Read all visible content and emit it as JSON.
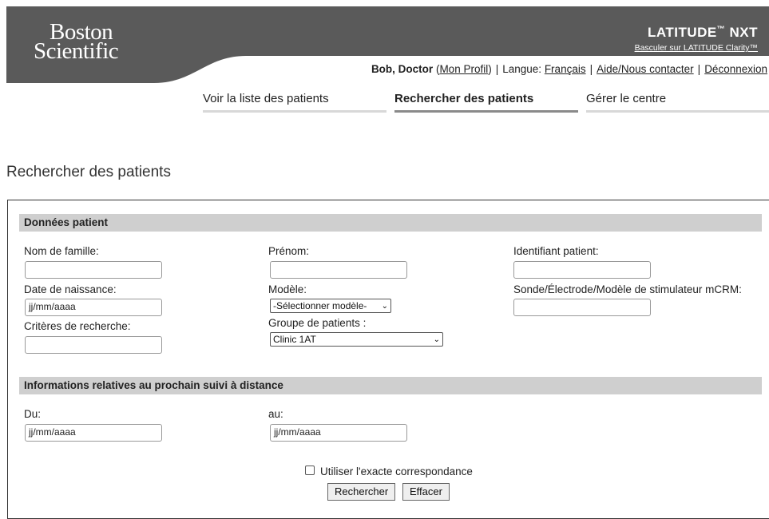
{
  "brand": {
    "logo_line1": "Boston",
    "logo_line2": "Scientific"
  },
  "product": {
    "name": "LATITUDE",
    "tm": "™",
    "suffix": " NXT",
    "switch_link": "Basculer sur LATITUDE Clarity™"
  },
  "userbar": {
    "user": "Bob, Doctor",
    "profile": "Mon Profil",
    "language_label": "Langue:",
    "language": "Français",
    "help": "Aide/Nous contacter",
    "logout": "Déconnexion"
  },
  "nav": {
    "tabs": [
      {
        "label": "Voir la liste des patients",
        "active": false
      },
      {
        "label": "Rechercher des patients",
        "active": true
      },
      {
        "label": "Gérer le centre",
        "active": false
      }
    ]
  },
  "page_title": "Rechercher des patients",
  "patient_section": {
    "title": "Données patient",
    "last_name_label": "Nom de famille:",
    "first_name_label": "Prénom:",
    "patient_id_label": "Identifiant patient:",
    "dob_label": "Date de naissance:",
    "dob_placeholder": "jj/mm/aaaa",
    "model_label": "Modèle:",
    "model_value": "-Sélectionner modèle-",
    "lead_label": "Sonde/Électrode/Modèle de stimulateur mCRM:",
    "criteria_label": "Critères de recherche:",
    "group_label": "Groupe de patients :",
    "group_value": "Clinic 1AT"
  },
  "followup_section": {
    "title": "Informations relatives au prochain suivi à distance",
    "from_label": "Du:",
    "to_label": "au:",
    "date_placeholder": "jj/mm/aaaa"
  },
  "exact_match_label": "Utiliser l'exacte correspondance",
  "buttons": {
    "search": "Rechercher",
    "clear": "Effacer"
  },
  "colors": {
    "header_bg": "#5a5a5a",
    "section_bg": "#cfcfcf",
    "active_tab_bar": "#8a8a8a"
  }
}
